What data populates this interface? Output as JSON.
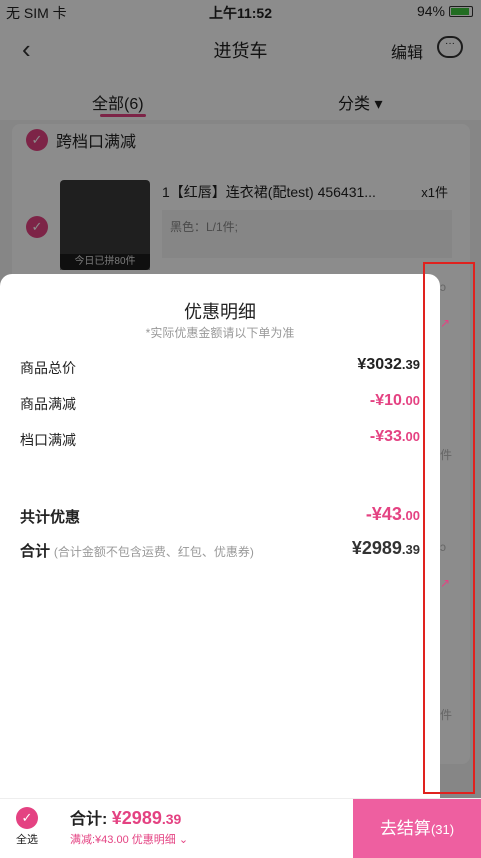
{
  "status": {
    "carrier": "无 SIM 卡",
    "time": "上午11:52",
    "battery": "94%"
  },
  "nav": {
    "title": "进货车",
    "edit": "编辑",
    "back_icon": "chevron-left-icon",
    "chat_icon": "chat-icon"
  },
  "tabs": {
    "all": "全部(6)",
    "category": "分类 ▾"
  },
  "store": {
    "name": "跨档口满减"
  },
  "item": {
    "title": "1【红唇】连衣裙(配test) 456431...",
    "qty": "x1件",
    "spec": "黑色：L/1件;",
    "tag": "今日已拼80件"
  },
  "sheet": {
    "title": "优惠明细",
    "subtitle": "*实际优惠金额请以下单为准",
    "rows": [
      {
        "label": "商品总价",
        "int": "¥3032",
        "dec": ".39"
      },
      {
        "label": "商品满减",
        "int": "-¥10",
        "dec": ".00"
      },
      {
        "label": "档口满减",
        "int": "-¥33",
        "dec": ".00"
      }
    ],
    "total_discount": {
      "label": "共计优惠",
      "int": "-¥43",
      "dec": ".00"
    },
    "total": {
      "label": "合计",
      "note": "(合计金额不包含运费、红包、优惠券)",
      "int": "¥2989",
      "dec": ".39"
    }
  },
  "peek": {
    "a": "ɔ",
    "b": "↗",
    "c": "件",
    "d": "ɔ",
    "e": "↗",
    "f": "件"
  },
  "bottom": {
    "select_all": "全选",
    "total_label": "合计: ",
    "total_int": "¥2989",
    "total_dec": ".39",
    "discount_line": "满减:¥43.00 优惠明细 ⌄",
    "checkout": "去结算",
    "checkout_count": "(31)"
  },
  "colors": {
    "accent": "#e44282",
    "checkout_bg": "#ee5fa0",
    "highlight": "#e0221e"
  }
}
